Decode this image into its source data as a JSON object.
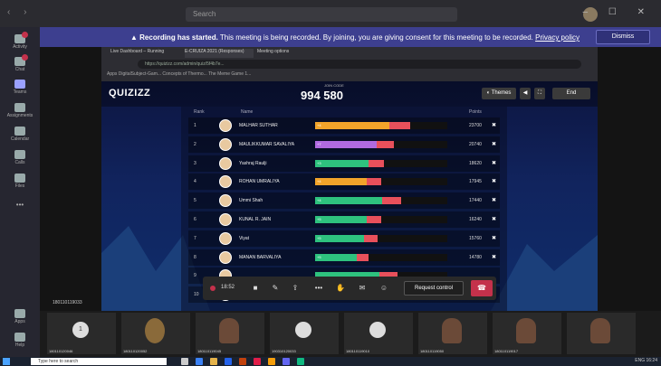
{
  "titlebar": {
    "search_placeholder": "Search",
    "nav": "‹ ›",
    "window_controls": "– ☐ ✕"
  },
  "rail": [
    {
      "label": "Activity"
    },
    {
      "label": "Chat"
    },
    {
      "label": "Teams"
    },
    {
      "label": "Assignments"
    },
    {
      "label": "Calendar"
    },
    {
      "label": "Calls"
    },
    {
      "label": "Files"
    },
    {
      "label": "•••"
    },
    {
      "label": "Apps"
    },
    {
      "label": "Help"
    }
  ],
  "banner": {
    "bold": "Recording has started.",
    "text": " This meeting is being recorded. By joining, you are giving consent for this meeting to be recorded. ",
    "link": "Privacy policy",
    "dismiss": "Dismiss"
  },
  "browser": {
    "tabs": [
      "Live Dashboard – Running",
      "E-CRUIZA 2021 (Responses)",
      "Meeting options"
    ],
    "url": "https://quizizz.com/admin/quiz/5f4b7e...",
    "bookmarks": "Apps   DigitalSubject-Gam...   Concepts of Thermo...   The Meme Game 1..."
  },
  "quiz": {
    "logo": "QUIZIZZ",
    "joincode_label": "JOIN CODE",
    "joincode": "994 580",
    "themes": "Themes",
    "end": "End",
    "headers": {
      "rank": "Rank",
      "name": "Name",
      "points": "Points"
    },
    "rows": [
      {
        "rank": "1",
        "name": "MALHAR SUTHAR",
        "streak": "+4",
        "points": "23700",
        "fill": 0.72,
        "color": "orange"
      },
      {
        "rank": "2",
        "name": "MAULIKKUMAR SAVALIYA",
        "streak": "+7",
        "points": "20740",
        "fill": 0.6,
        "color": "purple"
      },
      {
        "rank": "3",
        "name": "Yashraj Raulji",
        "streak": "+3",
        "points": "18620",
        "fill": 0.52,
        "color": "green"
      },
      {
        "rank": "4",
        "name": "ROHAN UMRALIYA",
        "streak": "+4",
        "points": "17945",
        "fill": 0.5,
        "color": "orange"
      },
      {
        "rank": "5",
        "name": "Ummi Shah",
        "streak": "+4",
        "points": "17440",
        "fill": 0.65,
        "color": "green"
      },
      {
        "rank": "6",
        "name": "KUNAL R. JAIN",
        "streak": "+5",
        "points": "16240",
        "fill": 0.5,
        "color": "green"
      },
      {
        "rank": "7",
        "name": "Viyat",
        "streak": "+5",
        "points": "15760",
        "fill": 0.47,
        "color": "green"
      },
      {
        "rank": "8",
        "name": "MANAN BARVALIYA",
        "streak": "+5",
        "points": "14780",
        "fill": 0.4,
        "color": "green"
      },
      {
        "rank": "9",
        "name": "",
        "streak": "",
        "points": "",
        "fill": 0.62,
        "color": "green"
      },
      {
        "rank": "10",
        "name": "",
        "streak": "",
        "points": "",
        "fill": 0.62,
        "color": "green"
      }
    ]
  },
  "uid_label": "180110119033",
  "controls": {
    "timer": "18:52",
    "request_control": "Request control"
  },
  "gallery": [
    {
      "label": "180110120046",
      "type": "circle",
      "initial": "1"
    },
    {
      "label": "180110120052",
      "type": "photo"
    },
    {
      "label": "180110119045",
      "type": "face"
    },
    {
      "label": "190310120033",
      "type": "circle",
      "initial": ""
    },
    {
      "label": "180110119010",
      "type": "circle",
      "initial": ""
    },
    {
      "label": "180110119050",
      "type": "face"
    },
    {
      "label": "180110119017",
      "type": "face"
    },
    {
      "label": "",
      "type": "face"
    }
  ],
  "taskbar": {
    "search": "Type here to search",
    "tray": "ENG  16:24"
  },
  "colors": {
    "green": "#2ec27e",
    "orange": "#f2a42a",
    "purple": "#b06ae0",
    "red": "#e8505b",
    "banner": "#3d3f8f"
  }
}
